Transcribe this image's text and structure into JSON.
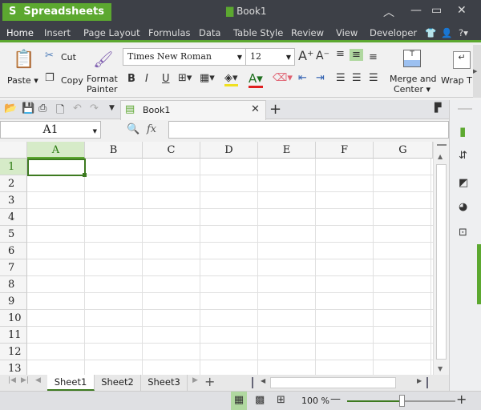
{
  "app": {
    "name": "Spreadsheets",
    "doc_title": "Book1"
  },
  "menu": [
    "Home",
    "Insert",
    "Page Layout",
    "Formulas",
    "Data",
    "Table Style",
    "Review",
    "View",
    "Developer"
  ],
  "ribbon": {
    "paste": "Paste",
    "cut": "Cut",
    "copy": "Copy",
    "format_painter_1": "Format",
    "format_painter_2": "Painter",
    "font": "Times New Roman",
    "size": "12",
    "merge_1": "Merge and",
    "merge_2": "Center",
    "wrap": "Wrap T"
  },
  "tab": {
    "label": "Book1"
  },
  "formula": {
    "name_box": "A1",
    "fx": "fx",
    "value": ""
  },
  "columns": [
    "A",
    "B",
    "C",
    "D",
    "E",
    "F",
    "G"
  ],
  "rows": [
    "1",
    "2",
    "3",
    "4",
    "5",
    "6",
    "7",
    "8",
    "9",
    "10",
    "11",
    "12",
    "13"
  ],
  "sheets": [
    "Sheet1",
    "Sheet2",
    "Sheet3"
  ],
  "status": {
    "zoom": "100 %",
    "zoom_percent": 100
  },
  "colors": {
    "accent": "#5ca830",
    "titlebar": "#3d4047"
  }
}
